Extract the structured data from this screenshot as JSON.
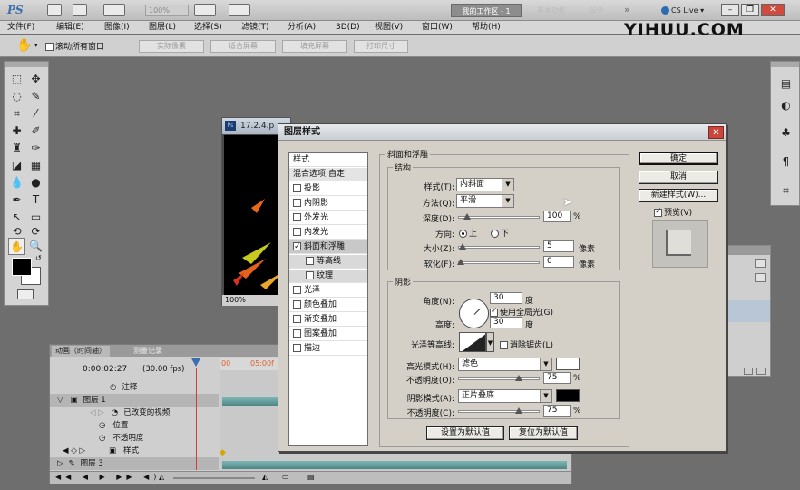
{
  "app": {
    "ps_label": "PS",
    "zoom": "100%",
    "workspaces": [
      "我的工作区 - 1",
      "基本功能",
      "设计"
    ],
    "overflow": "»",
    "cs_live": "CS Live",
    "logo": "YIHUU.COM"
  },
  "menu": [
    "文件(F)",
    "编辑(E)",
    "图像(I)",
    "图层(L)",
    "选择(S)",
    "滤镜(T)",
    "分析(A)",
    "3D(D)",
    "视图(V)",
    "窗口(W)",
    "帮助(H)"
  ],
  "options": {
    "scroll_all": "滚动所有窗口",
    "buttons": [
      "实际像素",
      "适合屏幕",
      "填充屏幕",
      "打印尺寸"
    ]
  },
  "document": {
    "title": "17.2.4.p",
    "zoom": "100%"
  },
  "timeline": {
    "tabs": [
      "动画（时间轴）",
      "测量记录"
    ],
    "timecode": "0:00:02:27",
    "fps": "(30.00 fps)",
    "ruler_start": "00",
    "ruler_mark": "05:00f",
    "rows": [
      "注释",
      "图层 1",
      "已改变的视频",
      "位置",
      "不透明度",
      "样式",
      "图层 3"
    ]
  },
  "dialog": {
    "title": "图层样式",
    "styles_header": "样式",
    "blend_options": "混合选项:自定",
    "style_items": [
      {
        "label": "投影",
        "checked": false
      },
      {
        "label": "内阴影",
        "checked": false
      },
      {
        "label": "外发光",
        "checked": false
      },
      {
        "label": "内发光",
        "checked": false
      },
      {
        "label": "斜面和浮雕",
        "checked": true
      },
      {
        "label": "等高线",
        "checked": false
      },
      {
        "label": "纹理",
        "checked": false
      },
      {
        "label": "光泽",
        "checked": false
      },
      {
        "label": "颜色叠加",
        "checked": false
      },
      {
        "label": "渐变叠加",
        "checked": false
      },
      {
        "label": "图案叠加",
        "checked": false
      },
      {
        "label": "描边",
        "checked": false
      }
    ],
    "section_title": "斜面和浮雕",
    "structure": {
      "label": "结构",
      "style_label": "样式(T):",
      "style_value": "内斜面",
      "method_label": "方法(Q):",
      "method_value": "平滑",
      "depth_label": "深度(D):",
      "depth_value": "100",
      "depth_unit": "%",
      "direction_label": "方向:",
      "dir_up": "上",
      "dir_down": "下",
      "size_label": "大小(Z):",
      "size_value": "5",
      "size_unit": "像素",
      "soften_label": "软化(F):",
      "soften_value": "0",
      "soften_unit": "像素"
    },
    "shading": {
      "label": "阴影",
      "angle_label": "角度(N):",
      "angle_value": "30",
      "angle_unit": "度",
      "global_light": "使用全局光(G)",
      "altitude_label": "高度:",
      "altitude_value": "30",
      "altitude_unit": "度",
      "gloss_label": "光泽等高线:",
      "antialias": "消除锯齿(L)",
      "highlight_mode_label": "高光模式(H):",
      "highlight_mode": "滤色",
      "highlight_color": "#ffffff",
      "highlight_opacity_label": "不透明度(O):",
      "highlight_opacity": "75",
      "shadow_mode_label": "阴影模式(A):",
      "shadow_mode": "正片叠底",
      "shadow_color": "#000000",
      "shadow_opacity_label": "不透明度(C):",
      "shadow_opacity": "75",
      "pct": "%"
    },
    "make_default": "设置为默认值",
    "reset_default": "复位为默认值",
    "ok": "确定",
    "cancel": "取消",
    "new_style": "新建样式(W)...",
    "preview": "预览(V)"
  },
  "colors": {
    "foreground": "#000000",
    "background": "#ffffff",
    "clip": "#4d8585",
    "playhead": "#d83a3a"
  }
}
